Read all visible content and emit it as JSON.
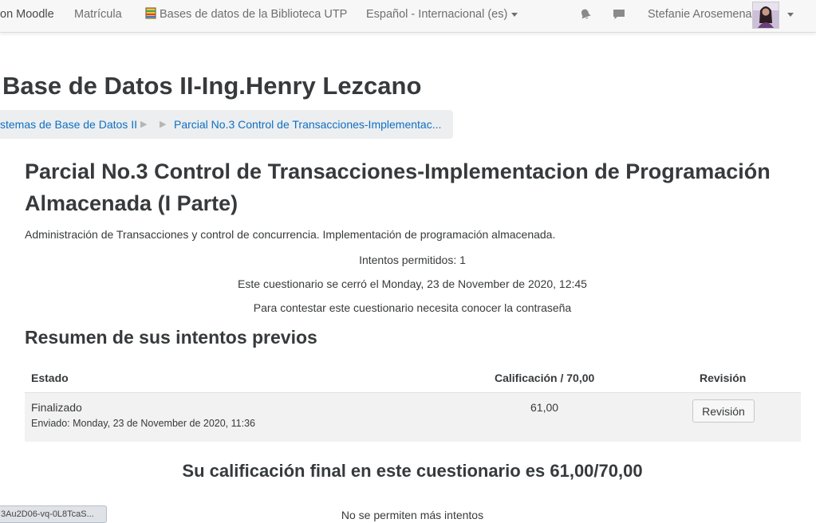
{
  "navbar": {
    "items": [
      {
        "label": "on Moodle"
      },
      {
        "label": "Matrícula"
      },
      {
        "label": "Bases de datos de la Biblioteca UTP"
      },
      {
        "label": "Español - Internacional (es)"
      }
    ],
    "user_name": "Stefanie Arosemena"
  },
  "page": {
    "course_title": "Base de Datos II-Ing.Henry Lezcano"
  },
  "breadcrumb": {
    "items": [
      {
        "label": "stemas de Base de Datos II"
      },
      {
        "label": "Parcial No.3 Control de Transacciones-Implementac..."
      }
    ]
  },
  "quiz": {
    "title": "Parcial No.3 Control de Transacciones-Implementacion de Programación Almacenada (I Parte)",
    "description": "Administración de Transacciones y control de concurrencia. Implementación de programación almacenada.",
    "info": [
      "Intentos permitidos: 1",
      "Este cuestionario se cerró el Monday, 23 de November de 2020, 12:45",
      "Para contestar este cuestionario necesita conocer la contraseña"
    ]
  },
  "summary": {
    "heading": "Resumen de sus intentos previos",
    "columns": [
      "Estado",
      "Calificación / 70,00",
      "Revisión"
    ],
    "rows": [
      {
        "state": "Finalizado",
        "submitted": "Enviado: Monday, 23 de November de 2020, 11:36",
        "grade": "61,00",
        "review_label": "Revisión"
      }
    ]
  },
  "final_grade": "Su calificación final en este cuestionario es 61,00/70,00",
  "no_more_attempts": "No se permiten más intentos",
  "status_bar_url": "3Au2D06-vq-0L8TcaS..."
}
